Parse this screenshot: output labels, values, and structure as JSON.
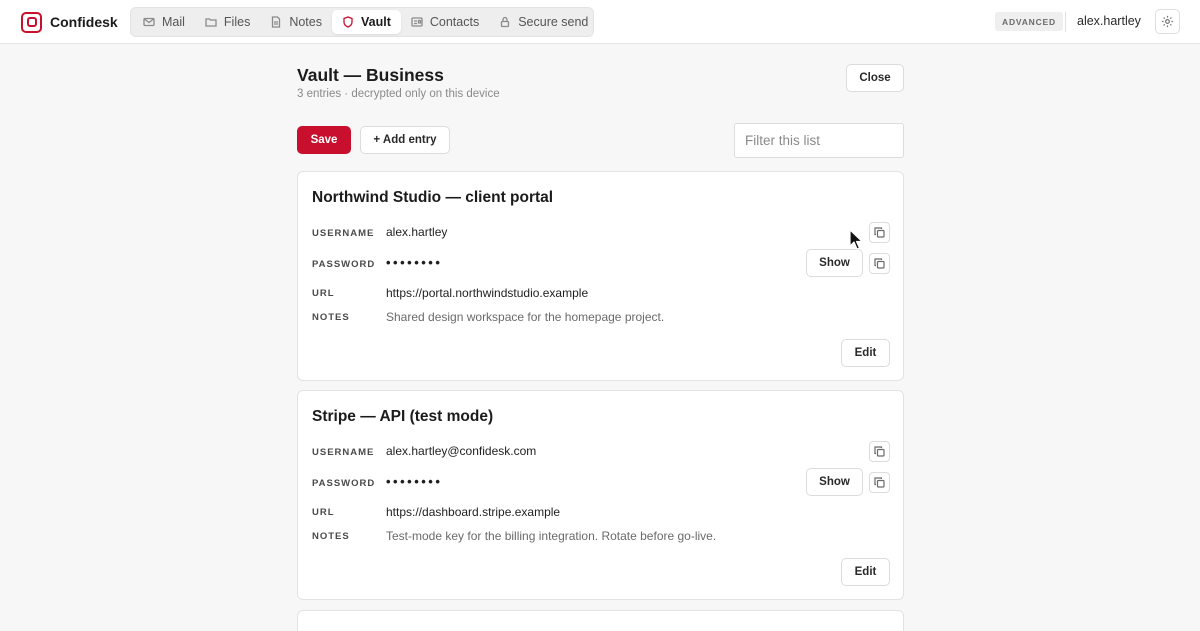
{
  "app": {
    "name": "Confidesk",
    "accent": "#c8102e"
  },
  "nav": {
    "tabs": [
      {
        "label": "Mail",
        "icon": "mail-icon"
      },
      {
        "label": "Files",
        "icon": "folder-icon"
      },
      {
        "label": "Notes",
        "icon": "document-icon"
      },
      {
        "label": "Vault",
        "icon": "shield-icon",
        "active": true
      },
      {
        "label": "Contacts",
        "icon": "contact-card-icon"
      },
      {
        "label": "Secure send",
        "icon": "lock-icon"
      }
    ]
  },
  "header": {
    "badge": "ADVANCED",
    "user": "alex.hartley",
    "settings_icon": "gear-icon"
  },
  "page": {
    "title": "Vault — Business",
    "subtitle": "3 entries · decrypted only on this device",
    "close_label": "Close",
    "save_label": "Save",
    "add_label": "+ Add entry",
    "filter_placeholder": "Filter this list"
  },
  "field_labels": {
    "username": "USERNAME",
    "password": "PASSWORD",
    "url": "URL",
    "notes": "NOTES"
  },
  "buttons": {
    "show": "Show",
    "edit": "Edit"
  },
  "entries": [
    {
      "title": "Northwind Studio — client portal",
      "username": "alex.hartley",
      "password_mask": "••••••••",
      "url": "https://portal.northwindstudio.example",
      "notes": "Shared design workspace for the homepage project."
    },
    {
      "title": "Stripe — API (test mode)",
      "username": "alex.hartley@confidesk.com",
      "password_mask": "••••••••",
      "url": "https://dashboard.stripe.example",
      "notes": "Test-mode key for the billing integration. Rotate before go-live."
    }
  ]
}
